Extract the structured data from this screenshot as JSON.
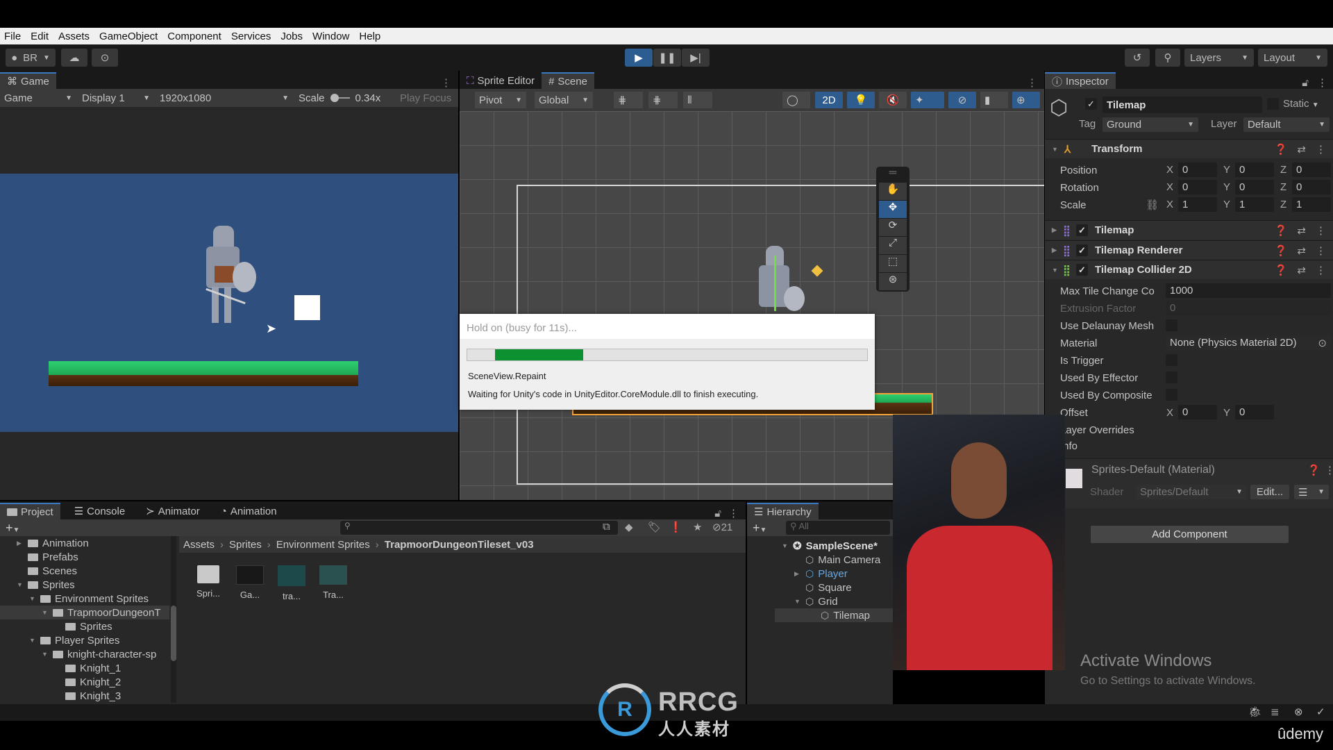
{
  "menu": [
    "File",
    "Edit",
    "Assets",
    "GameObject",
    "Component",
    "Services",
    "Jobs",
    "Window",
    "Help"
  ],
  "toolbar": {
    "account": "BR",
    "layers_label": "Layers",
    "layout_label": "Layout"
  },
  "game_panel": {
    "tab": "Game",
    "mode": "Game",
    "display": "Display 1",
    "resolution": "1920x1080",
    "scale_label": "Scale",
    "scale_value": "0.34x",
    "play_focus": "Play Focus",
    "bg_color": "#2f4f7f"
  },
  "scene_panel": {
    "tabs": [
      "Sprite Editor",
      "Scene"
    ],
    "pivot": "Pivot",
    "global": "Global",
    "mode_2d": "2D"
  },
  "busy_dialog": {
    "title": "Hold on (busy for 11s)...",
    "progress_start": 0.07,
    "progress_end": 0.29,
    "task": "SceneView.Repaint",
    "message": "Waiting for Unity's code in UnityEditor.CoreModule.dll to finish executing."
  },
  "inspector": {
    "tab": "Inspector",
    "object_name": "Tilemap",
    "static_label": "Static",
    "tag_label": "Tag",
    "tag_value": "Ground",
    "layer_label": "Layer",
    "layer_value": "Default",
    "transform": {
      "title": "Transform",
      "rows": [
        {
          "label": "Position",
          "x": "0",
          "y": "0",
          "z": "0"
        },
        {
          "label": "Rotation",
          "x": "0",
          "y": "0",
          "z": "0"
        },
        {
          "label": "Scale",
          "x": "1",
          "y": "1",
          "z": "1"
        }
      ]
    },
    "components": [
      "Tilemap",
      "Tilemap Renderer",
      "Tilemap Collider 2D"
    ],
    "collider": {
      "max_tile_label": "Max Tile Change Co",
      "max_tile_value": "1000",
      "extrusion_label": "Extrusion Factor",
      "extrusion_value": "0",
      "delaunay_label": "Use Delaunay Mesh",
      "material_label": "Material",
      "material_value": "None (Physics Material 2D)",
      "trigger_label": "Is Trigger",
      "effector_label": "Used By Effector",
      "composite_label": "Used By Composite",
      "offset_label": "Offset",
      "offset_x": "0",
      "offset_y": "0",
      "layer_overrides": "Layer Overrides",
      "info": "Info"
    },
    "material": {
      "name": "Sprites-Default (Material)",
      "shader_label": "Shader",
      "shader_value": "Sprites/Default",
      "edit": "Edit..."
    },
    "add_component": "Add Component"
  },
  "project": {
    "tabs": [
      "Project",
      "Console",
      "Animator",
      "Animation"
    ],
    "tree": [
      {
        "label": "Animation",
        "depth": 0,
        "arrow": "right"
      },
      {
        "label": "Prefabs",
        "depth": 0,
        "arrow": ""
      },
      {
        "label": "Scenes",
        "depth": 0,
        "arrow": ""
      },
      {
        "label": "Sprites",
        "depth": 0,
        "arrow": "down"
      },
      {
        "label": "Environment Sprites",
        "depth": 1,
        "arrow": "down"
      },
      {
        "label": "TrapmoorDungeonT",
        "depth": 2,
        "arrow": "down"
      },
      {
        "label": "Sprites",
        "depth": 3,
        "arrow": ""
      },
      {
        "label": "Player Sprites",
        "depth": 1,
        "arrow": "down"
      },
      {
        "label": "knight-character-sp",
        "depth": 2,
        "arrow": "down"
      },
      {
        "label": "Knight_1",
        "depth": 3,
        "arrow": ""
      },
      {
        "label": "Knight_2",
        "depth": 3,
        "arrow": ""
      },
      {
        "label": "Knight_3",
        "depth": 3,
        "arrow": ""
      }
    ],
    "breadcrumb": [
      "Assets",
      "Sprites",
      "Environment Sprites",
      "TrapmoorDungeonTileset_v03"
    ],
    "assets": [
      "Spri...",
      "Ga...",
      "tra...",
      "Tra..."
    ],
    "hidden_count": "21"
  },
  "hierarchy": {
    "tab": "Hierarchy",
    "search_placeholder": "All",
    "scene": "SampleScene*",
    "items": [
      {
        "label": "Main Camera",
        "depth": 1,
        "arrow": ""
      },
      {
        "label": "Player",
        "depth": 1,
        "arrow": "right",
        "prefab": true
      },
      {
        "label": "Square",
        "depth": 1,
        "arrow": ""
      },
      {
        "label": "Grid",
        "depth": 1,
        "arrow": "down"
      },
      {
        "label": "Tilemap",
        "depth": 2,
        "arrow": ""
      }
    ]
  },
  "watermarks": {
    "activate_title": "Activate Windows",
    "activate_sub": "Go to Settings to activate Windows.",
    "rrcg": "RRCG",
    "rrcg_cn": "人人素材",
    "udemy": "ûdemy"
  }
}
